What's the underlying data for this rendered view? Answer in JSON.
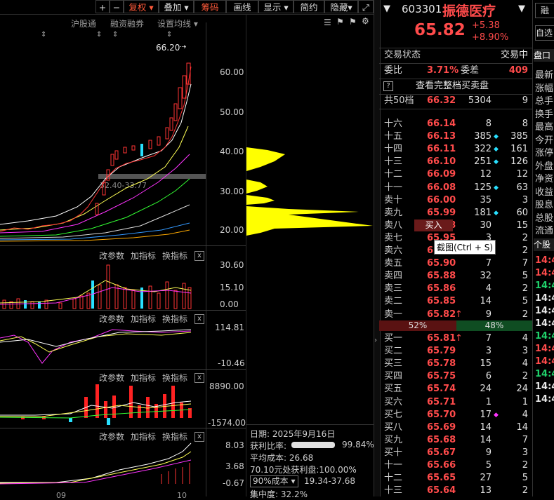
{
  "toolbar": {
    "plus": "+",
    "minus": "−",
    "fuquan": "复权",
    "diejia": "叠加",
    "chouma": "筹码",
    "huaxian": "画线",
    "xianshi": "显示",
    "jianyue": "简约",
    "yincang": "隐藏"
  },
  "chart": {
    "top_tabs": [
      "沪股通",
      "融资融券",
      "设置均线"
    ],
    "high_label": "66.20",
    "price_axis": [
      "60.00",
      "50.00",
      "40.00",
      "30.00",
      "20.00"
    ],
    "chip_range_label": "32.40-33.77",
    "ind_buttons": [
      "改参数",
      "加指标",
      "换指标"
    ],
    "close_x": "x",
    "vol_axis": [
      "30.60",
      "15.10",
      "0.00"
    ],
    "macd_axis": [
      "114.81",
      "-10.46"
    ],
    "p3_axis": [
      "8890.00",
      "-1574.00"
    ],
    "p4_axis": [
      "8.03",
      "3.68",
      "-0.67"
    ],
    "date_ticks": [
      "09",
      "10"
    ]
  },
  "chip_panel": {
    "date_label": "日期:",
    "date": "2025年9月16日",
    "profit_label": "获利比率:",
    "profit_ratio": 0.9984,
    "profit_value": "99.84%",
    "avg_cost_label": "平均成本:",
    "avg_cost": "26.68",
    "profit_at": "70.10元处获利盘:",
    "profit_at_value": "100.00%",
    "cost_select": "90%成本",
    "cost_range": "19.34-37.68",
    "concentration_label": "集中度:",
    "concentration": "32.2%"
  },
  "quote": {
    "code": "603301",
    "name": "振德医疗",
    "price": "65.82",
    "change": "+5.38",
    "change_pct": "+8.90%",
    "status_label": "交易状态",
    "status_value": "交易中",
    "weibi_label": "委比",
    "weibi": "3.71%",
    "weicha_label": "委差",
    "weicha": "409",
    "full_book": "查看完整档买卖盘",
    "depth_label": "共50档",
    "depth_price": "66.32",
    "depth_vol": "5304",
    "depth_cnt": "9",
    "asks": [
      {
        "label": "十六",
        "price": "66.14",
        "vol": "8",
        "chg": "8",
        "mark": false
      },
      {
        "label": "十五",
        "price": "66.13",
        "vol": "385",
        "chg": "385",
        "mark": true
      },
      {
        "label": "十四",
        "price": "66.11",
        "vol": "322",
        "chg": "161",
        "mark": true
      },
      {
        "label": "十三",
        "price": "66.10",
        "vol": "251",
        "chg": "126",
        "mark": true
      },
      {
        "label": "十二",
        "price": "66.09",
        "vol": "12",
        "chg": "12",
        "mark": false
      },
      {
        "label": "十一",
        "price": "66.08",
        "vol": "125",
        "chg": "63",
        "mark": true
      },
      {
        "label": "卖十",
        "price": "66.00",
        "vol": "35",
        "chg": "3",
        "mark": false
      },
      {
        "label": "卖九",
        "price": "65.99",
        "vol": "181",
        "chg": "60",
        "mark": true
      },
      {
        "label": "卖八",
        "price": "65.98",
        "vol": "30",
        "chg": "15",
        "mark": false
      },
      {
        "label": "卖七",
        "price": "65.95",
        "vol": "3",
        "chg": "2",
        "mark": false
      },
      {
        "label": "卖六",
        "price": "65.92",
        "vol": "4",
        "chg": "2",
        "mark": false
      },
      {
        "label": "卖五",
        "price": "65.90",
        "vol": "7",
        "chg": "7",
        "mark": false
      },
      {
        "label": "卖四",
        "price": "65.88",
        "vol": "32",
        "chg": "5",
        "mark": false
      },
      {
        "label": "卖三",
        "price": "65.86",
        "vol": "4",
        "chg": "2",
        "mark": false
      },
      {
        "label": "卖二",
        "price": "65.85",
        "vol": "14",
        "chg": "5",
        "mark": false
      },
      {
        "label": "卖一",
        "price": "65.82",
        "vol": "9",
        "chg": "2",
        "mark": false
      }
    ],
    "sell_pct": "52%",
    "buy_pct": "48%",
    "bids": [
      {
        "label": "买一",
        "price": "65.81",
        "vol": "7",
        "chg": "4",
        "mark": false
      },
      {
        "label": "买二",
        "price": "65.79",
        "vol": "3",
        "chg": "3",
        "mark": false
      },
      {
        "label": "买三",
        "price": "65.78",
        "vol": "15",
        "chg": "4",
        "mark": false
      },
      {
        "label": "买四",
        "price": "65.75",
        "vol": "6",
        "chg": "2",
        "mark": false
      },
      {
        "label": "买五",
        "price": "65.74",
        "vol": "24",
        "chg": "24",
        "mark": false
      },
      {
        "label": "买六",
        "price": "65.71",
        "vol": "1",
        "chg": "1",
        "mark": false
      },
      {
        "label": "买七",
        "price": "65.70",
        "vol": "17",
        "chg": "4",
        "mark": true
      },
      {
        "label": "买八",
        "price": "65.69",
        "vol": "14",
        "chg": "14",
        "mark": false
      },
      {
        "label": "买九",
        "price": "65.68",
        "vol": "14",
        "chg": "7",
        "mark": false
      },
      {
        "label": "买十",
        "price": "65.67",
        "vol": "9",
        "chg": "3",
        "mark": false
      },
      {
        "label": "十一",
        "price": "65.66",
        "vol": "5",
        "chg": "2",
        "mark": false
      },
      {
        "label": "十二",
        "price": "65.65",
        "vol": "27",
        "chg": "5",
        "mark": false
      },
      {
        "label": "十三",
        "price": "65.64",
        "vol": "13",
        "chg": "2",
        "mark": false
      }
    ],
    "buy_btn": "买入",
    "tooltip": "截图(Ctrl + S)"
  },
  "far_right": {
    "btn1": "融",
    "btn2": "自选",
    "tab": "盘口",
    "items": [
      "最新",
      "涨幅",
      "总手",
      "换手",
      "最高",
      "今开",
      "涨停",
      "外盘",
      "净资",
      "收益",
      "股息",
      "总股",
      "流通"
    ],
    "tab2": "个股",
    "times": [
      {
        "t": "14:4",
        "c": "red"
      },
      {
        "t": "14:4",
        "c": "red"
      },
      {
        "t": "14:4",
        "c": "green"
      },
      {
        "t": "14:4",
        "c": "white"
      },
      {
        "t": "14:4",
        "c": "white"
      },
      {
        "t": "14:4",
        "c": "white"
      },
      {
        "t": "14:4",
        "c": "green"
      },
      {
        "t": "14:4",
        "c": "red"
      },
      {
        "t": "14:4",
        "c": "red"
      },
      {
        "t": "14:4",
        "c": "green"
      },
      {
        "t": "14:4",
        "c": "white"
      },
      {
        "t": "14:4",
        "c": "white"
      }
    ]
  }
}
